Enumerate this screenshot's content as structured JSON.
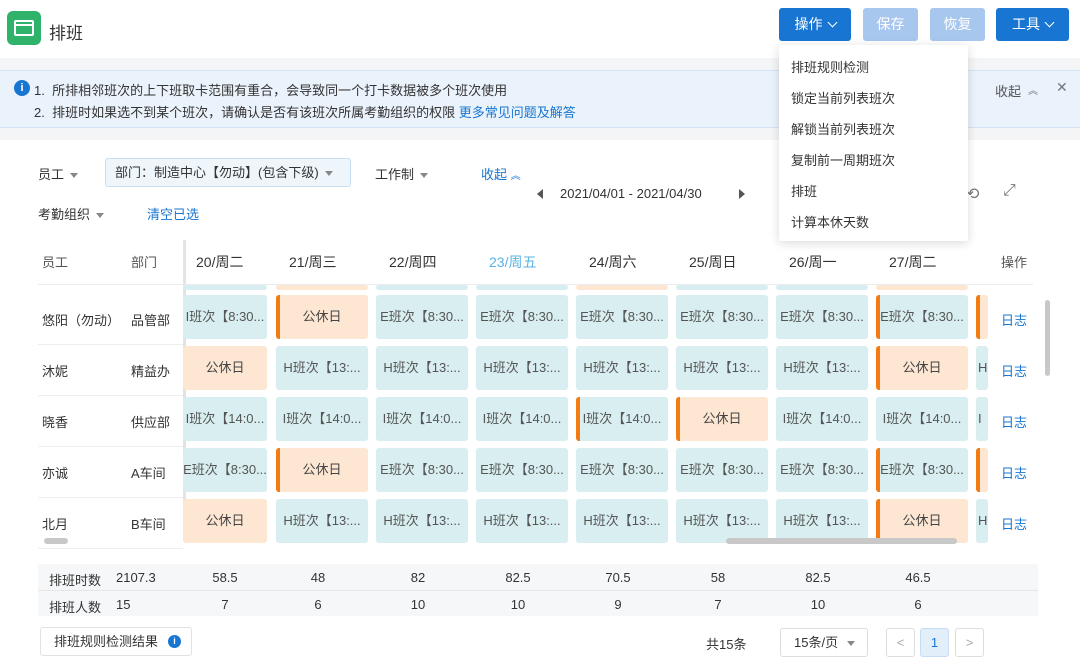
{
  "app": {
    "title": "排班"
  },
  "toolbar": {
    "operate": "操作",
    "save": "保存",
    "restore": "恢复",
    "tools": "工具"
  },
  "notice": {
    "line1_index": "1.",
    "line1": "所排相邻班次的上下班取卡范围有重合，会导致同一个打卡数据被多个班次使用",
    "line2_index": "2.",
    "line2": "排班时如果选不到某个班次，请确认是否有该班次所属考勤组织的权限",
    "faq_link": "更多常见问题及解答",
    "collapse": "收起"
  },
  "menu": {
    "items": [
      "排班规则检测",
      "锁定当前列表班次",
      "解锁当前列表班次",
      "复制前一周期班次",
      "排班",
      "计算本休天数"
    ]
  },
  "filters": {
    "employee": "员工",
    "department": "部门：制造中心【勿动】(包含下级)",
    "work_system": "工作制",
    "collapse": "收起",
    "attendance_org": "考勤组织",
    "clear": "清空已选",
    "date_range": "2021/04/01 - 2021/04/30"
  },
  "table": {
    "col_employee": "员工",
    "col_department": "部门",
    "col_action": "操作",
    "days": [
      "20/周二",
      "21/周三",
      "22/周四",
      "23/周五",
      "24/周六",
      "25/周日",
      "26/周一",
      "27/周二"
    ],
    "today_index": 3,
    "log_label": "日志",
    "rows": [
      {
        "name": "悠阳（勿动）",
        "dept": "品管部",
        "cells": [
          {
            "t": "I班次【8:30...",
            "k": "work",
            "m": false
          },
          {
            "t": "公休日",
            "k": "rest",
            "m": true
          },
          {
            "t": "E班次【8:30...",
            "k": "work",
            "m": false
          },
          {
            "t": "E班次【8:30...",
            "k": "work",
            "m": false
          },
          {
            "t": "E班次【8:30...",
            "k": "work",
            "m": false
          },
          {
            "t": "E班次【8:30...",
            "k": "work",
            "m": false
          },
          {
            "t": "E班次【8:30...",
            "k": "work",
            "m": false
          },
          {
            "t": "E班次【8:30...",
            "k": "work",
            "m": true
          }
        ],
        "edge": {
          "k": "rest",
          "m": true
        }
      },
      {
        "name": "沐妮",
        "dept": "精益办",
        "cells": [
          {
            "t": "公休日",
            "k": "rest",
            "m": false
          },
          {
            "t": "H班次【13:...",
            "k": "work",
            "m": false
          },
          {
            "t": "H班次【13:...",
            "k": "work",
            "m": false
          },
          {
            "t": "H班次【13:...",
            "k": "work",
            "m": false
          },
          {
            "t": "H班次【13:...",
            "k": "work",
            "m": false
          },
          {
            "t": "H班次【13:...",
            "k": "work",
            "m": false
          },
          {
            "t": "H班次【13:...",
            "k": "work",
            "m": false
          },
          {
            "t": "公休日",
            "k": "rest",
            "m": true
          }
        ],
        "edge": {
          "t": "H",
          "k": "work",
          "m": false
        }
      },
      {
        "name": "晓香",
        "dept": "供应部",
        "cells": [
          {
            "t": "I班次【14:0...",
            "k": "work",
            "m": false
          },
          {
            "t": "I班次【14:0...",
            "k": "work",
            "m": false
          },
          {
            "t": "I班次【14:0...",
            "k": "work",
            "m": false
          },
          {
            "t": "I班次【14:0...",
            "k": "work",
            "m": false
          },
          {
            "t": "I班次【14:0...",
            "k": "work",
            "m": true
          },
          {
            "t": "公休日",
            "k": "rest",
            "m": true
          },
          {
            "t": "I班次【14:0...",
            "k": "work",
            "m": false
          },
          {
            "t": "I班次【14:0...",
            "k": "work",
            "m": false
          }
        ],
        "edge": {
          "t": "I",
          "k": "work",
          "m": false
        }
      },
      {
        "name": "亦诚",
        "dept": "A车间",
        "cells": [
          {
            "t": "E班次【8:30...",
            "k": "work",
            "m": false
          },
          {
            "t": "公休日",
            "k": "rest",
            "m": true
          },
          {
            "t": "E班次【8:30...",
            "k": "work",
            "m": false
          },
          {
            "t": "E班次【8:30...",
            "k": "work",
            "m": false
          },
          {
            "t": "E班次【8:30...",
            "k": "work",
            "m": false
          },
          {
            "t": "E班次【8:30...",
            "k": "work",
            "m": false
          },
          {
            "t": "E班次【8:30...",
            "k": "work",
            "m": false
          },
          {
            "t": "E班次【8:30...",
            "k": "work",
            "m": true
          }
        ],
        "edge": {
          "k": "rest",
          "m": true
        }
      },
      {
        "name": "北月",
        "dept": "B车间",
        "cells": [
          {
            "t": "公休日",
            "k": "rest",
            "m": false
          },
          {
            "t": "H班次【13:...",
            "k": "work",
            "m": false
          },
          {
            "t": "H班次【13:...",
            "k": "work",
            "m": false
          },
          {
            "t": "H班次【13:...",
            "k": "work",
            "m": false
          },
          {
            "t": "H班次【13:...",
            "k": "work",
            "m": false
          },
          {
            "t": "H班次【13:...",
            "k": "work",
            "m": false
          },
          {
            "t": "H班次【13:...",
            "k": "work",
            "m": false
          },
          {
            "t": "公休日",
            "k": "rest",
            "m": true
          }
        ],
        "edge": {
          "t": "H",
          "k": "work",
          "m": false
        }
      }
    ]
  },
  "summary": {
    "hours_label": "排班时数",
    "hours_total": "2107.3",
    "hours": [
      "58.5",
      "48",
      "82",
      "82.5",
      "70.5",
      "58",
      "82.5",
      "46.5"
    ],
    "count_label": "排班人数",
    "count_total": "15",
    "counts": [
      "7",
      "6",
      "10",
      "10",
      "9",
      "7",
      "10",
      "6"
    ]
  },
  "footer": {
    "check_result": "排班规则检测结果",
    "total": "共15条",
    "page_size": "15条/页",
    "prev": "<",
    "page": "1",
    "next": ">"
  },
  "colors": {
    "primary": "#1876d2",
    "work_cell": "#d8eef0",
    "rest_cell": "#fde6d2",
    "lock_mark": "#f27b13"
  }
}
